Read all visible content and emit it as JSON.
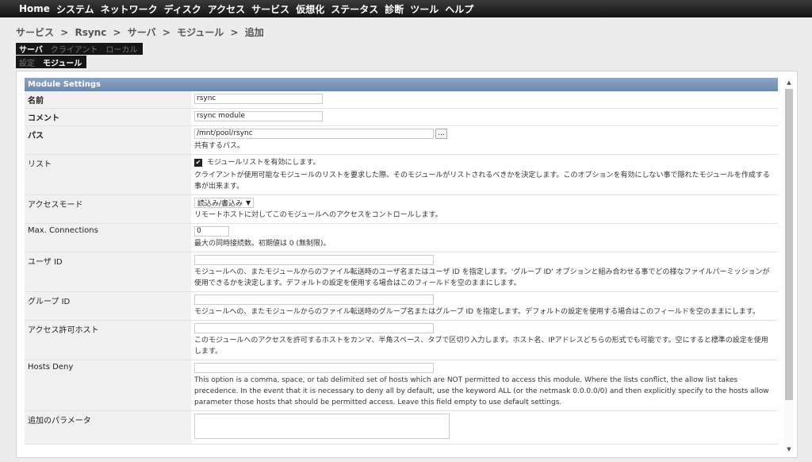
{
  "menu": [
    "Home",
    "システム",
    "ネットワーク",
    "ディスク",
    "アクセス",
    "サービス",
    "仮想化",
    "ステータス",
    "診断",
    "ツール",
    "ヘルプ"
  ],
  "breadcrumb": [
    "サービス",
    "&gt;",
    "Rsync",
    "&gt;",
    "サーバ",
    "&gt;",
    "モジュール",
    "&gt;",
    "追加"
  ],
  "tabs_row1": [
    {
      "label": "サーバ",
      "active": true
    },
    {
      "label": "クライアント",
      "active": false
    },
    {
      "label": "ローカル",
      "active": false
    }
  ],
  "tabs_row2": [
    {
      "label": "設定",
      "active": false
    },
    {
      "label": "モジュール",
      "active": true
    }
  ],
  "section_title": "Module Settings",
  "fields": {
    "name": {
      "label": "名前",
      "value": "rsync"
    },
    "comment": {
      "label": "コメント",
      "value": "rsync module"
    },
    "path": {
      "label": "パス",
      "value": "/mnt/pool/rsync",
      "browse": "...",
      "desc": "共有するパス。"
    },
    "list": {
      "label": "リスト",
      "checkbox": "モジュールリストを有効にします。",
      "checked": true,
      "desc": "クライアントが使用可能なモジュールのリストを要求した際、そのモジュールがリストされるべきかを決定します。このオプションを有効にしない事で隠れたモジュールを作成する事が出来ます。"
    },
    "access_mode": {
      "label": "アクセスモード",
      "value": "読込み/書込み",
      "desc": "リモートホストに対してこのモジュールへのアクセスをコントロールします。"
    },
    "max_connections": {
      "label": "Max. Connections",
      "value": "0",
      "desc": "最大の同時接続数。初期値は 0 (無制限)。"
    },
    "user_id": {
      "label": "ユーザ ID",
      "value": "",
      "desc": "モジュールへの、またモジュールからのファイル転送時のユーザ名またはユーザ ID を指定します。'グループ ID' オプションと組み合わせる事でどの様なファイルパーミッションが使用できるかを決定します。デフォルトの設定を使用する場合はこのフィールドを空のままにします。"
    },
    "group_id": {
      "label": "グループ ID",
      "value": "",
      "desc": "モジュールへの、またモジュールからのファイル転送時のグループ名またはグループ ID を指定します。デフォルトの設定を使用する場合はこのフィールドを空のままにします。"
    },
    "hosts_allow": {
      "label": "アクセス許可ホスト",
      "value": "",
      "desc": "このモジュールへのアクセスを許可するホストをカンマ、半角スペース、タブで区切り入力します。ホスト名、IPアドレスどちらの形式でも可能です。空にすると標準の設定を使用します。"
    },
    "hosts_deny": {
      "label": "Hosts Deny",
      "value": "",
      "desc": "This option is a comma, space, or tab delimited set of hosts which are NOT permitted to access this module. Where the lists conflict, the allow list takes precedence. In the event that it is necessary to deny all by default, use the keyword ALL (or the netmask 0.0.0.0/0) and then explicitly specify to the hosts allow parameter those hosts that should be permitted access. Leave this field empty to use default settings."
    },
    "aux_params": {
      "label": "追加のパラメータ",
      "value": ""
    }
  }
}
